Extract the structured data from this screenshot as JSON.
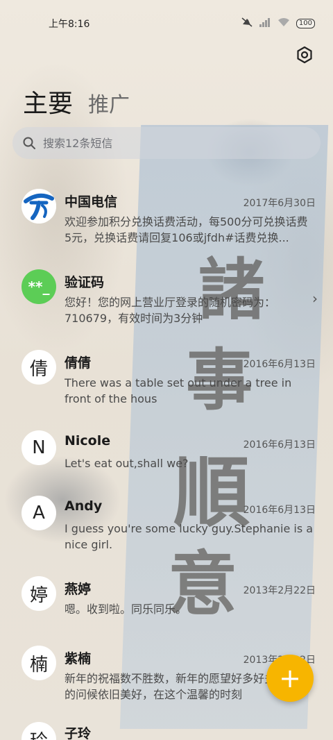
{
  "status": {
    "time": "上午8:16",
    "battery": "100"
  },
  "tabs": {
    "main": "主要",
    "promo": "推广"
  },
  "search": {
    "placeholder": "搜索12条短信"
  },
  "conversations": [
    {
      "name": "中国电信",
      "date": "2017年6月30日",
      "preview": "欢迎参加积分兑换话费活动，每500分可兑换话费5元，兑换话费请回复106或jfdh#话费兑换...",
      "avatar": "telecom-logo"
    },
    {
      "name": "验证码",
      "preview": "您好！您的网上营业厅登录的随机密码为：710679，有效时间为3分钟",
      "avatar_text": "**_"
    },
    {
      "name": "倩倩",
      "date": "2016年6月13日",
      "preview": "There was a table set out under a tree in front of the hous",
      "avatar_text": "倩"
    },
    {
      "name": "Nicole",
      "date": "2016年6月13日",
      "preview": "Let's eat out,shall we?",
      "avatar_text": "N"
    },
    {
      "name": "Andy",
      "date": "2016年6月13日",
      "preview": "I guess you're some lucky guy.Stephanie is a nice girl.",
      "avatar_text": "A"
    },
    {
      "name": "燕婷",
      "date": "2013年2月22日",
      "preview": "嗯。收到啦。同乐同乐。",
      "avatar_text": "婷"
    },
    {
      "name": "紫楠",
      "date": "2013年2月22日",
      "preview": "新年的祝福数不胜数，新年的愿望好多好多，新年的问候依旧美好，在这个温馨的时刻",
      "avatar_text": "楠"
    },
    {
      "name": "子玲",
      "avatar_text": "玲"
    }
  ],
  "fab": {
    "label": "+"
  },
  "wallpaper": {
    "brush_text": [
      "諸",
      "事",
      "順",
      "意"
    ]
  },
  "colors": {
    "fab": "#f7b500",
    "verify_avatar": "#5ccd56",
    "telecom_blue": "#1565c0"
  }
}
